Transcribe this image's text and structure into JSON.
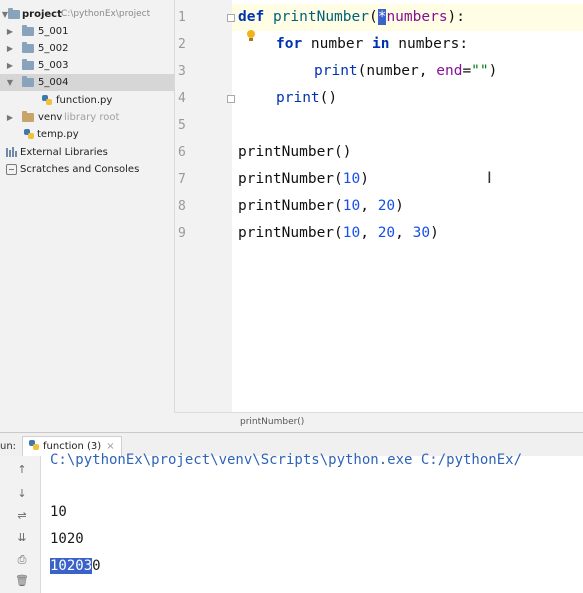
{
  "project_tree": {
    "root": {
      "name": "project",
      "path": "C:\\pythonEx\\project"
    },
    "items": [
      {
        "label": "5_001"
      },
      {
        "label": "5_002"
      },
      {
        "label": "5_003"
      },
      {
        "label": "5_004"
      },
      {
        "label": "function.py"
      },
      {
        "label": "venv",
        "hint": "library root"
      },
      {
        "label": "temp.py"
      },
      {
        "label": "External Libraries"
      },
      {
        "label": "Scratches and Consoles"
      }
    ]
  },
  "editor": {
    "line_numbers": [
      "1",
      "2",
      "3",
      "4",
      "5",
      "6",
      "7",
      "8",
      "9"
    ],
    "line1": {
      "kw": "def",
      "fn": "printNumber",
      "open": "(",
      "caret_char": "*",
      "param": "numbers",
      "close": "):"
    },
    "line2": {
      "kw_for": "for",
      "var": " number ",
      "kw_in": "in",
      "rest": " numbers:"
    },
    "line3": {
      "fn": "print",
      "open": "(number, ",
      "param": "end",
      "eq": "=",
      "str": "\"\"",
      "close": ")"
    },
    "line4": {
      "fn": "print",
      "rest": "()"
    },
    "line6": {
      "fn": "printNumber",
      "rest": "()"
    },
    "line7": {
      "fn": "printNumber",
      "open": "(",
      "n1": "10",
      "close": ")"
    },
    "line8": {
      "fn": "printNumber",
      "open": "(",
      "n1": "10",
      "sep1": ", ",
      "n2": "20",
      "close": ")"
    },
    "line9": {
      "fn": "printNumber",
      "open": "(",
      "n1": "10",
      "sep1": ", ",
      "n2": "20",
      "sep2": ", ",
      "n3": "30",
      "close": ")"
    },
    "breadcrumb": "printNumber()"
  },
  "run_panel": {
    "label": "un:",
    "tab": {
      "name": "function (3)",
      "close": "×"
    },
    "console": {
      "command": "C:\\pythonEx\\project\\venv\\Scripts\\python.exe C:/pythonEx/",
      "outputs": [
        "10",
        "1020"
      ],
      "last_selected": "10203",
      "last_rest": "0"
    },
    "tools": {
      "up": "↑",
      "down": "↓",
      "wrap": "⇌",
      "scroll_end": "⇊",
      "print": "⎙",
      "trash": "🗑"
    }
  }
}
